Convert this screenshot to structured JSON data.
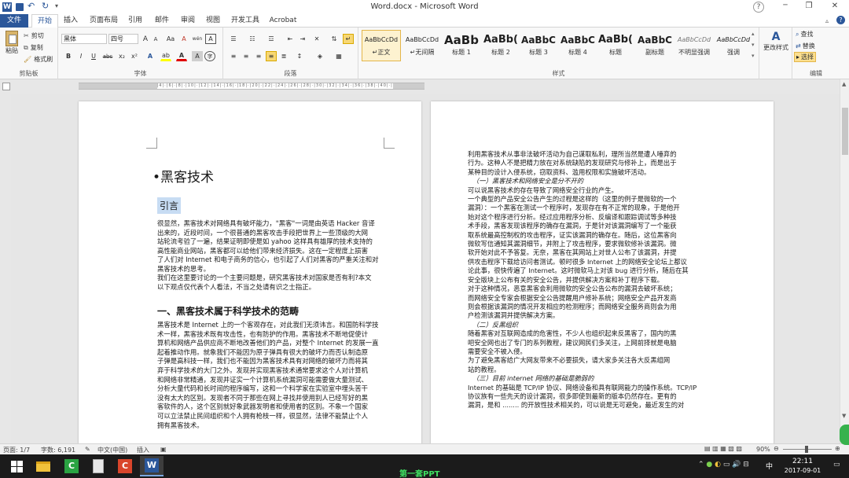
{
  "window": {
    "title": "Word.docx - Microsoft Word",
    "help": "?",
    "minimize": "─",
    "restore": "❐",
    "close": "✕"
  },
  "qat": {
    "word_icon": "W",
    "save": "💾",
    "undo": "↶",
    "redo": "↻",
    "more": "▾"
  },
  "tabs": [
    "文件",
    "开始",
    "插入",
    "页面布局",
    "引用",
    "邮件",
    "审阅",
    "视图",
    "开发工具",
    "Acrobat"
  ],
  "active_tab": "开始",
  "ribbon": {
    "clipboard": {
      "label": "剪贴板",
      "paste": "粘贴",
      "cut": "剪切",
      "copy": "复制",
      "format_painter": "格式刷"
    },
    "font": {
      "label": "字体",
      "font_name": "黑体",
      "font_size": "四号",
      "bold": "B",
      "italic": "I",
      "underline": "U",
      "strike": "abc",
      "sub": "x₂",
      "sup": "x²",
      "grow": "A",
      "shrink": "A",
      "change_case": "Aa",
      "clear": "A",
      "phonetic": "wén",
      "border": "A",
      "highlight": "ab",
      "color": "A",
      "shade": "A",
      "circle": "字"
    },
    "paragraph": {
      "label": "段落"
    },
    "styles": {
      "label": "样式",
      "change_styles": "更改样式",
      "items": [
        {
          "sample": "AaBbCcDd",
          "name": "↵正文"
        },
        {
          "sample": "AaBbCcDd",
          "name": "↵无间隔"
        },
        {
          "sample": "AaBb",
          "name": "标题 1"
        },
        {
          "sample": "AaBb(",
          "name": "标题 2"
        },
        {
          "sample": "AaBbC",
          "name": "标题 3"
        },
        {
          "sample": "AaBbC",
          "name": "标题 4"
        },
        {
          "sample": "AaBb(",
          "name": "标题"
        },
        {
          "sample": "AaBbC",
          "name": "副标题"
        },
        {
          "sample": "AaBbCcDd",
          "name": "不明显强调"
        },
        {
          "sample": "AaBbCcDd",
          "name": "强调"
        }
      ]
    },
    "editing": {
      "label": "编辑",
      "find": "查找",
      "replace": "替换",
      "select": "选择"
    }
  },
  "page1": {
    "title": "黑客技术",
    "intro_heading": "引言",
    "para1": [
      "很显然，黑客技术对网络具有破坏能力，\"黑客\"一词是由英语 Hacker 音译",
      "出来的，近段时间，一个很普通的黑客攻击手段把世界上一些顶级的大网",
      "站轮流考验了一遍，结果证明即使是如 yahoo 这样具有雄厚的技术支持的",
      "高性能商业网站，黑客都可以给他们带来经济损失。这在一定程度上损害",
      "了人们对 Internet 和电子商务的信心，也引起了人们对黑客的严重关注和对",
      "黑客技术的思考。"
    ],
    "para2": [
      "我们在这里要讨论的一个主要问题是，研究黑客技术对国家是否有利?本文",
      "以下观点仅代表个人看法，不当之处请有识之士指正。"
    ],
    "heading1": "一、黑客技术属于科学技术的范畴",
    "para3": [
      "黑客技术是 Internet 上的一个客观存在，对此我们无须讳言。和国防科学技",
      "术一样，黑客技术既有攻击性，也有防护的作用。黑客技术不断地促使计",
      "算机和网络产品供应商不断地改善他们的产品，对整个 Internet 的发展一直",
      "起着推动作用。就象我们不能因为原子弹具有很大的破坏力而否认制造原",
      "子弹是高科技一样，我们也不能因为黑客技术具有对网络的破坏力而将其",
      "弃于科学技术的大门之外。发现并实现黑客技术通常要求这个人对计算机",
      "和网络非常精通，发现并证实一个计算机系统漏洞可能需要做大量测试、",
      "分析大量代码和长时间的程序编写，这和一个科学家在实验室中埋头苦干",
      "没有太大的区别。发现者不同于那些在网上寻找并使用别人已经写好的黑",
      "客软件的人，这个区别就好象武器发明者和使用者的区别。不象一个国家",
      "可以立法禁止民间组织和个人拥有枪枝一样，很显然，法律不能禁止个人",
      "拥有黑客技术。"
    ]
  },
  "page2": {
    "lines": [
      {
        "t": "利用黑客技术从事非法破坏活动为自己谋取私利，理所当然是遭人唾弃的",
        "s": "n"
      },
      {
        "t": "行为。这种人不是把精力放在对系统缺陷的发现研究与修补上，而是出于",
        "s": "n"
      },
      {
        "t": "某种目的设计入侵系统，窃取资料、滥用权限和实施破坏活动。",
        "s": "n"
      },
      {
        "t": "（一）黑客技术和网络安全是分不开的",
        "s": "i"
      },
      {
        "t": "可以说黑客技术的存在导致了网络安全行业的产生。",
        "s": "n"
      },
      {
        "t": "一个典型的产品安全公告产生的过程是这样的（这里的例子是微软的一个",
        "s": "n"
      },
      {
        "t": "漏洞）：一个黑客在测试一个程序时，发现存在有不正常的现象，于是他开",
        "s": "n"
      },
      {
        "t": "始对这个程序进行分析。经过应用程序分析、反编译和跟踪调试等多种技",
        "s": "n"
      },
      {
        "t": "术手段，黑客发现该程序的确存在漏洞，于是针对该漏洞编写了一个能获",
        "s": "n"
      },
      {
        "t": "取系统最高控制权的攻击程序，证实该漏洞的确存在。随后，这位黑客向",
        "s": "n"
      },
      {
        "t": "微软写信通知其漏洞细节，并附上了攻击程序，要求微软修补该漏洞。微",
        "s": "n"
      },
      {
        "t": "软开始对此不予答复。无奈，黑客在其网站上对世人公布了该漏洞，并提",
        "s": "n"
      },
      {
        "t": "供攻击程序下载给访问者测试。顿时很多 Internet 上的网络安全论坛上都议",
        "s": "n"
      },
      {
        "t": "论此事，很快传遍了 Internet。这时微软马上对该 bug 进行分析，随后在其",
        "s": "n"
      },
      {
        "t": "安全版块上公布有关的安全公告，并提供解决方案和补丁程序下载。",
        "s": "n"
      },
      {
        "t": "对于这种情况，恶意黑客会利用微软的安全公告公布的漏洞去破坏系统；",
        "s": "n"
      },
      {
        "t": "而网络安全专家会根据安全公告提醒用户修补系统；网络安全产品开发商",
        "s": "n"
      },
      {
        "t": "则会根据该漏洞的情况开发相应的检测程序；而网络安全服务商则会为用",
        "s": "n"
      },
      {
        "t": "户检测该漏洞并提供解决方案。",
        "s": "n"
      },
      {
        "t": "（二）反黑组织",
        "s": "i"
      },
      {
        "t": "随着黑客对互联网造成的危害性，不少人也组织起来反黑客了，国内的黑",
        "s": "n"
      },
      {
        "t": "吧安全网也出了专门的系列教程，建议网民们多关注，上网前择就是电脑",
        "s": "n"
      },
      {
        "t": "需要安全不被入侵。",
        "s": "n"
      },
      {
        "t": "为了避免黑客给广大网友带来不必要损失，请大家多关注各大反黑组网",
        "s": "n"
      },
      {
        "t": "站的教程。",
        "s": "n"
      },
      {
        "t": "（三）目前 internet 网络的基础是脆弱的",
        "s": "i"
      },
      {
        "t": "Internet 的基础是 TCP/IP 协议、网络设备和具有联网能力的操作系统。TCP/IP",
        "s": "n"
      },
      {
        "t": "协议族有一些先天的设计漏洞，很多即使到最新的版本仍然存在。更有的",
        "s": "n"
      },
      {
        "t": "漏洞，是和 ........ 的开放性技术相关的，可以说是无可避免，最近发生的对",
        "s": "n"
      }
    ]
  },
  "status": {
    "page": "页面: 1/7",
    "words": "字数: 6,191",
    "lang": "中文(中国)",
    "mode": "插入",
    "zoom": "90%"
  },
  "taskbar": {
    "center_text": "第一套PPT",
    "time": "22:11",
    "date": "2017-09-01",
    "ime": "中"
  }
}
